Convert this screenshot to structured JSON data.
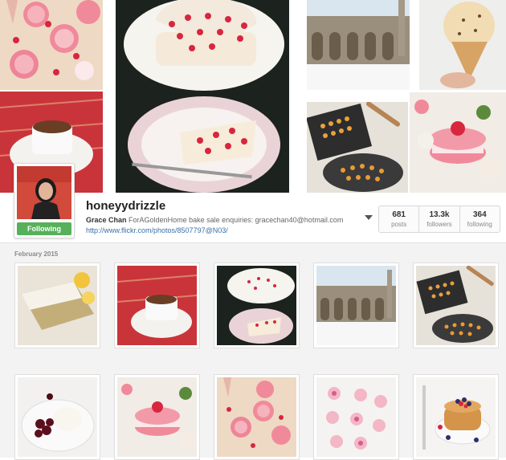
{
  "profile": {
    "username": "honeyydrizzle",
    "full_name": "Grace Chan",
    "bio": "ForAGoldenHome bake sale enquiries: gracechan40@hotmail.com",
    "website": "http://www.flickr.com/photos/8507797@N03/",
    "follow_label": "Following"
  },
  "stats": [
    {
      "value": "681",
      "label": "posts"
    },
    {
      "value": "13.3k",
      "label": "followers"
    },
    {
      "value": "364",
      "label": "following"
    }
  ],
  "feed": {
    "month_label": "February 2015"
  },
  "colors": {
    "follow_green": "#56b15a",
    "link_blue": "#3a6fa6",
    "macaron_pink": "#f08a9a",
    "raspberry": "#d8263f"
  }
}
